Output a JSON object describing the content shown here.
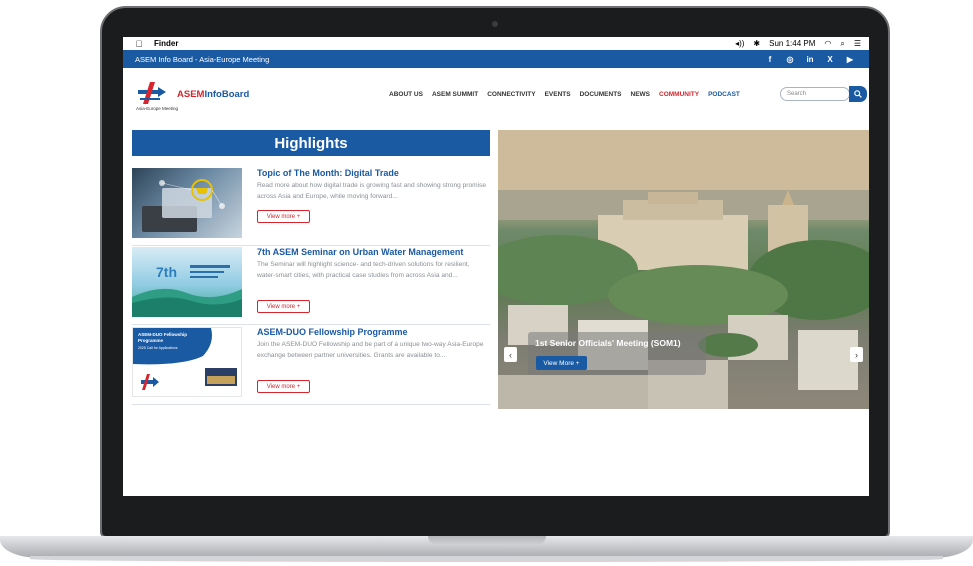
{
  "menubar": {
    "apple_icon": "",
    "app_name": "Finder",
    "volume_icon": "◂))",
    "bluetooth_icon": "✱",
    "clock": "Sun 1:44 PM",
    "wifi_icon": "◠",
    "search_icon": "⌕",
    "menu_icon": "☰"
  },
  "topbar": {
    "title": "ASEM Info Board - Asia-Europe Meeting",
    "social": {
      "facebook": "f",
      "instagram": "◎",
      "linkedin": "in",
      "x": "X",
      "youtube": "▶"
    }
  },
  "header": {
    "logo_text_a": "ASEM",
    "logo_text_b": "InfoBoard",
    "logo_sub": "Asia-Europe Meeting",
    "nav": [
      "ABOUT US",
      "ASEM SUMMIT",
      "CONNECTIVITY",
      "EVENTS",
      "DOCUMENTS",
      "NEWS",
      "COMMUNITY",
      "PODCAST"
    ],
    "search_placeholder": "Search",
    "search_button_icon": "🔍"
  },
  "highlights": {
    "heading": "Highlights",
    "articles": [
      {
        "title": "Topic of The Month: Digital Trade",
        "desc": "Read more about how digital trade is growing fast and showing strong promise across Asia and Europe, while moving forward...",
        "button": "View more +"
      },
      {
        "title": "7th ASEM Seminar on Urban Water Management",
        "desc": "The Seminar will highlight science- and tech-driven solutions for resilient, water-smart cities, with practical case studies from across Asia and...",
        "button": "View more +"
      },
      {
        "title": "ASEM-DUO Fellowship Programme",
        "desc": "Join the ASEM-DUO Fellowship and be part of a unique two-way Asia-Europe exchange between partner universities. Grants are available to...",
        "button": "View more +"
      }
    ],
    "thumb3_title": "ASEM-DUO Fellowship Programme",
    "thumb3_sub": "2025 Call for Applications"
  },
  "slider": {
    "caption": "1st Senior Officials' Meeting (SOM1)",
    "button": "View More +",
    "prev_icon": "‹",
    "next_icon": "›"
  },
  "colors": {
    "brand_blue": "#1a5aa3",
    "brand_red": "#d6252d"
  }
}
